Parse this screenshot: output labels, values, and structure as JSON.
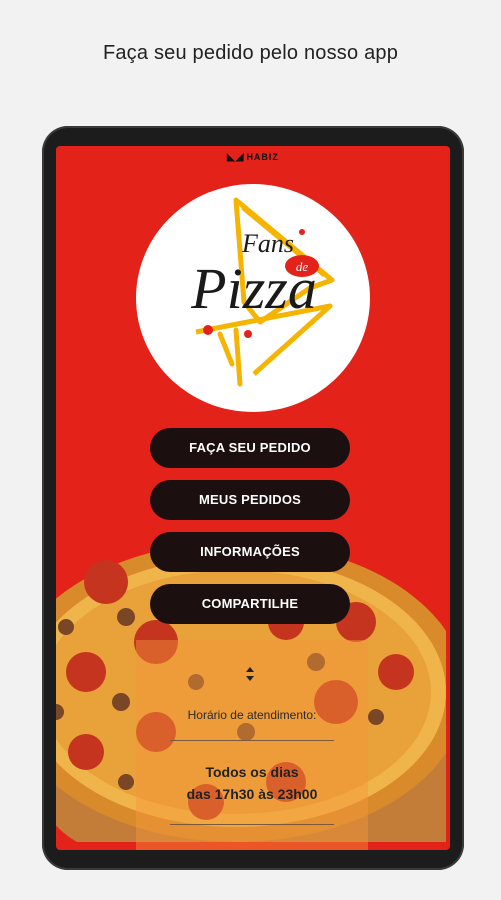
{
  "caption": "Faça seu pedido pelo nosso app",
  "platform": {
    "brand": "HABIZ",
    "icon": "habiz-logo-icon"
  },
  "logo": {
    "line1": "Fans",
    "line2": "de",
    "line3": "Pizza"
  },
  "menu": {
    "order": "FAÇA SEU PEDIDO",
    "my_orders": "MEUS PEDIDOS",
    "info": "INFORMAÇÕES",
    "share": "COMPARTILHE"
  },
  "hours": {
    "label": "Horário de atendimento:",
    "line1": "Todos os dias",
    "line2": "das 17h30 às 23h00"
  },
  "colors": {
    "background": "#e3221a",
    "button": "#1b0f0f",
    "accent": "#f4b400"
  }
}
